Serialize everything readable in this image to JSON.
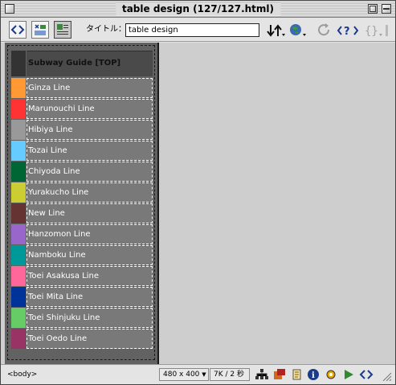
{
  "window": {
    "title": "table design (127/127.html)"
  },
  "toolbar": {
    "title_label": "タイトル：",
    "title_value": "table design"
  },
  "colors": {
    "panel_bg": "#626262",
    "cell_bg": "#797979",
    "workarea_bg": "#cecece"
  },
  "table": {
    "header": {
      "label": "Subway Guide [TOP]",
      "swatch": "#333333"
    },
    "lines": [
      {
        "label": "Ginza Line",
        "color": "#ff9933"
      },
      {
        "label": "Marunouchi Line",
        "color": "#ff3333"
      },
      {
        "label": "Hibiya Line",
        "color": "#999999"
      },
      {
        "label": "Tozai Line",
        "color": "#66ccff"
      },
      {
        "label": "Chiyoda Line",
        "color": "#006633"
      },
      {
        "label": "Yurakucho Line",
        "color": "#cccc33"
      },
      {
        "label": "New Line",
        "color": "#663333"
      },
      {
        "label": "Hanzomon Line",
        "color": "#9966cc"
      },
      {
        "label": "Namboku Line",
        "color": "#009999"
      },
      {
        "label": "Toei Asakusa Line",
        "color": "#ff6699"
      },
      {
        "label": "Toei Mita Line",
        "color": "#003399"
      },
      {
        "label": "Toei Shinjuku Line",
        "color": "#66cc66"
      },
      {
        "label": "Toei Oedo Line",
        "color": "#993366"
      }
    ]
  },
  "statusbar": {
    "tag": "<body>",
    "window_size": "480 x 400",
    "download": "7K / 2 秒"
  }
}
